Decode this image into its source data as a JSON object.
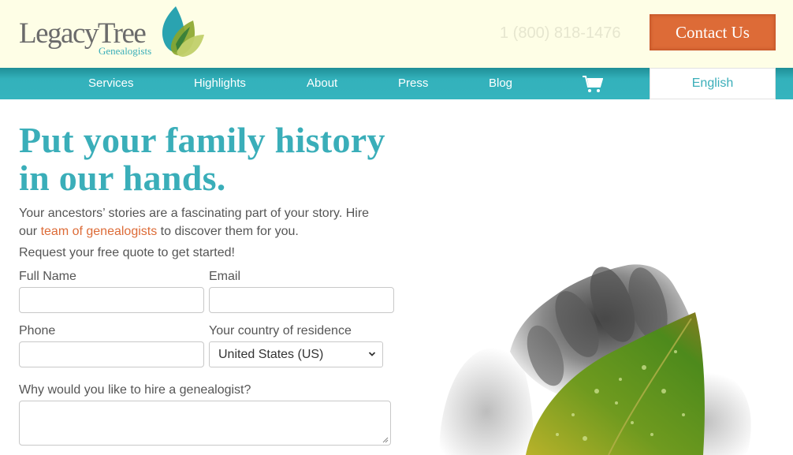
{
  "header": {
    "logo": {
      "wordmark": "LegacyTree",
      "subtitle": "Genealogists"
    },
    "phone": "1 (800) 818-1476",
    "contact_label": "Contact Us"
  },
  "nav": {
    "items": [
      {
        "label": "Services"
      },
      {
        "label": "Highlights"
      },
      {
        "label": "About"
      },
      {
        "label": "Press"
      },
      {
        "label": "Blog"
      }
    ],
    "cart_icon": "shopping-cart-icon",
    "language": "English"
  },
  "hero": {
    "title_line1": "Put your family history",
    "title_line2": "in our hands.",
    "intro_before": "Your ancestors’ stories are a fascinating part of your story. Hire our ",
    "intro_link": "team of genealogists",
    "intro_after": " to discover them for you.",
    "cta": "Request your free quote to get started!"
  },
  "form": {
    "full_name": {
      "label": "Full Name",
      "value": ""
    },
    "email": {
      "label": "Email",
      "value": ""
    },
    "phone": {
      "label": "Phone",
      "value": ""
    },
    "country": {
      "label": "Your country of residence",
      "selected": "United States (US)"
    },
    "reason": {
      "label": "Why would you like to hire a genealogist?",
      "value": ""
    }
  },
  "image": {
    "alt": "Hands holding a green leaf with water droplets"
  },
  "colors": {
    "header_bg": "#fefee6",
    "teal": "#3aaeb9",
    "orange": "#dd6b37",
    "text": "#555555"
  }
}
